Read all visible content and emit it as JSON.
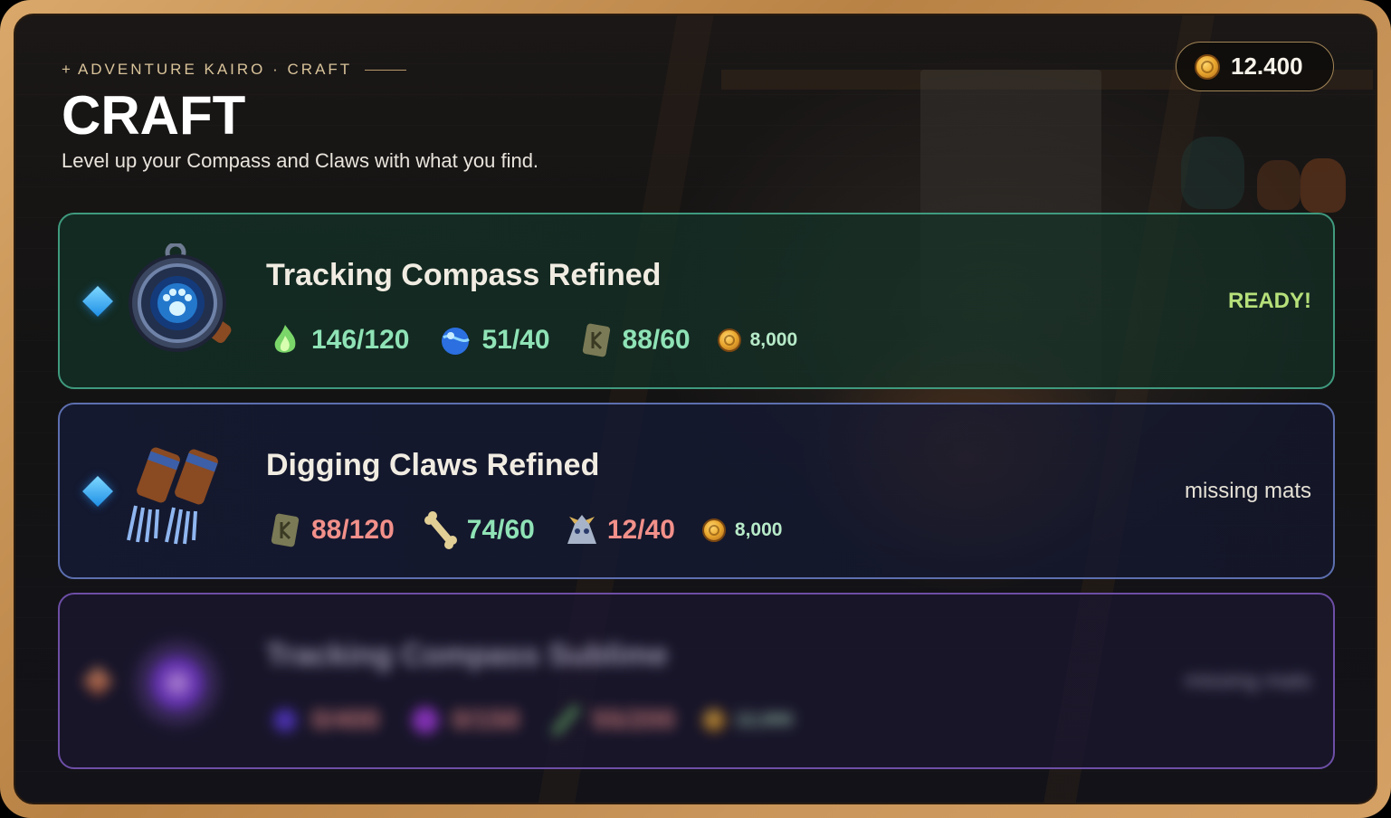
{
  "header": {
    "breadcrumb": "ADVENTURE KAIRO · CRAFT",
    "title": "CRAFT",
    "subtitle": "Level up your Compass and Claws with what you find."
  },
  "currency": {
    "icon": "gold-coin-icon",
    "amount": "12.400"
  },
  "recipes": [
    {
      "name": "Tracking Compass Refined",
      "item_icon": "tracking-compass-icon",
      "status": "READY!",
      "state": "ready",
      "materials": [
        {
          "icon": "green-flame-icon",
          "qty": "146/120",
          "enough": true
        },
        {
          "icon": "blue-orb-icon",
          "qty": "51/40",
          "enough": true
        },
        {
          "icon": "rune-stone-icon",
          "qty": "88/60",
          "enough": true
        }
      ],
      "cost": {
        "icon": "gold-coin-icon",
        "amount": "8,000"
      }
    },
    {
      "name": "Digging Claws Refined",
      "item_icon": "digging-claws-icon",
      "status": "missing mats",
      "state": "missing",
      "materials": [
        {
          "icon": "rune-stone-icon",
          "qty": "88/120",
          "enough": false
        },
        {
          "icon": "bone-icon",
          "qty": "74/60",
          "enough": true
        },
        {
          "icon": "skull-icon",
          "qty": "12/40",
          "enough": false
        }
      ],
      "cost": {
        "icon": "gold-coin-icon",
        "amount": "8,000"
      }
    },
    {
      "name": "Tracking Compass Sublime",
      "item_icon": "purple-compass-icon",
      "status": "missing mats",
      "state": "locked",
      "materials": [
        {
          "icon": "purple-gem-icon",
          "qty": "0/400",
          "enough": false
        },
        {
          "icon": "purple-orb-icon",
          "qty": "0/150",
          "enough": false
        },
        {
          "icon": "feather-icon",
          "qty": "55/200",
          "enough": false
        }
      ],
      "cost": {
        "icon": "gold-coin-icon",
        "amount": "12,000"
      }
    }
  ],
  "colors": {
    "frame": "#c9955a",
    "ready_border": "#3f9a7e",
    "missing_border": "#5d6fb0",
    "locked_border": "#6d4ea6",
    "qty_ok": "#8fe3b6",
    "qty_short": "#f2908a",
    "ready_text": "#b6e07a"
  }
}
